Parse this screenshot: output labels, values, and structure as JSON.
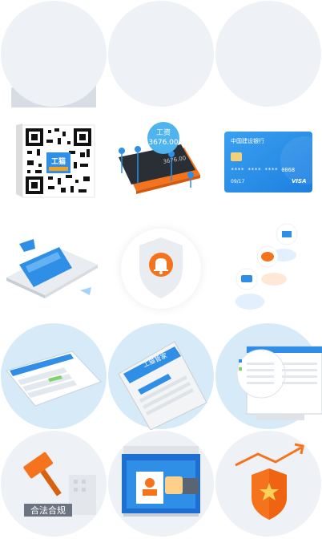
{
  "colors": {
    "orange": "#f5731c",
    "blue": "#2f8fe6",
    "circle_bg": "#eef2f6",
    "light_blue_bg": "#d7ebf8",
    "dark_blue": "#1e6fd1"
  },
  "icons": [
    "shield-check-icon",
    "growth-chart-icon",
    "money-card-icon",
    "qr-code-icon",
    "salary-chart-icon",
    "bank-card-icon",
    "phone-message-icon",
    "shield-bell-icon",
    "notification-bubbles-icon",
    "laptop-app-icon",
    "phone-app-icon",
    "desktop-app-icon",
    "legal-gavel-icon",
    "document-approval-icon",
    "shield-star-icon"
  ],
  "salary_chart": {
    "title": "工资",
    "amount": "3676.00",
    "back_amount": "3676.00"
  },
  "bank_card": {
    "bank_name": "中国建设银行",
    "number_masked": "**** **** **** 0068",
    "expiry": "09/17",
    "brand": "VISA"
  },
  "qr": {
    "logo_text": "工猫"
  },
  "legal": {
    "caption": "合法合规"
  },
  "money_card": {
    "symbol": "¥"
  },
  "phone_app": {
    "header": "工猫管家"
  }
}
